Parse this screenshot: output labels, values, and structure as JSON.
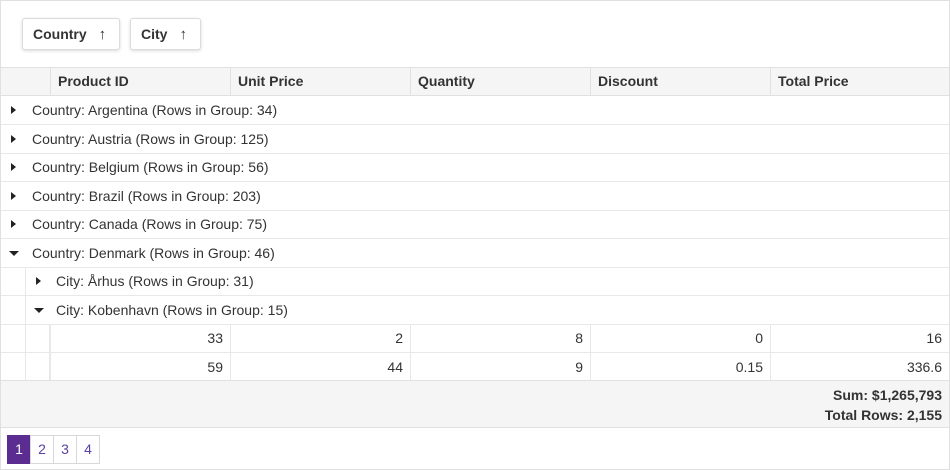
{
  "group_panel": {
    "chips": [
      {
        "label": "Country",
        "arrow": "↑"
      },
      {
        "label": "City",
        "arrow": "↑"
      }
    ]
  },
  "columns": [
    "Product ID",
    "Unit Price",
    "Quantity",
    "Discount",
    "Total Price"
  ],
  "groups": [
    {
      "text": "Country: Argentina (Rows in Group: 34)",
      "expanded": false
    },
    {
      "text": "Country: Austria (Rows in Group: 125)",
      "expanded": false
    },
    {
      "text": "Country: Belgium (Rows in Group: 56)",
      "expanded": false
    },
    {
      "text": "Country: Brazil (Rows in Group: 203)",
      "expanded": false
    },
    {
      "text": "Country: Canada (Rows in Group: 75)",
      "expanded": false
    },
    {
      "text": "Country: Denmark (Rows in Group: 46)",
      "expanded": true
    }
  ],
  "subgroups": [
    {
      "text": "City: Århus (Rows in Group: 31)",
      "expanded": false
    },
    {
      "text": "City: Kobenhavn (Rows in Group: 15)",
      "expanded": true
    }
  ],
  "rows": [
    [
      "33",
      "2",
      "8",
      "0",
      "16"
    ],
    [
      "59",
      "44",
      "9",
      "0.15",
      "336.6"
    ]
  ],
  "summary": {
    "sum": "Sum: $1,265,793",
    "total_rows": "Total Rows: 2,155"
  },
  "pager": {
    "pages": [
      "1",
      "2",
      "3",
      "4"
    ],
    "active": "1"
  },
  "colors": {
    "accent": "#5c2d91",
    "header_bg": "#f5f5f5"
  }
}
